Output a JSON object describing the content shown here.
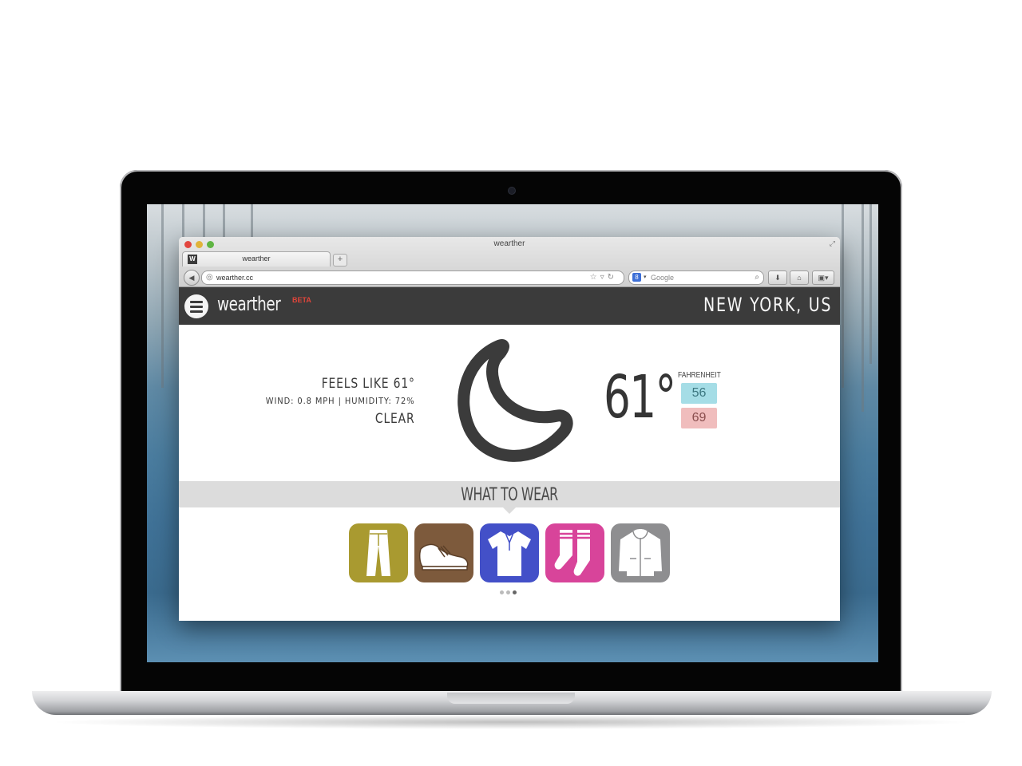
{
  "browser": {
    "window_title": "wearther",
    "tab_label": "wearther",
    "tab_favicon": "W",
    "new_tab": "+",
    "url": "wearther.cc",
    "search_placeholder": "Google"
  },
  "site": {
    "brand": "wearther",
    "beta": "BETA",
    "location": "NEW YORK, US"
  },
  "weather": {
    "feels_like": "FEELS LIKE 61°",
    "wind_humidity": "WIND: 0.8 MPH | HUMIDITY: 72%",
    "condition": "CLEAR",
    "condition_icon": "moon-icon",
    "temperature": "61°",
    "unit": "FAHRENHEIT",
    "low": "56",
    "high": "69"
  },
  "wear": {
    "title": "WHAT TO WEAR",
    "items": [
      {
        "name": "pants-icon",
        "color": "#a99a30"
      },
      {
        "name": "shoe-icon",
        "color": "#7d5a3c"
      },
      {
        "name": "polo-shirt-icon",
        "color": "#4350c8"
      },
      {
        "name": "socks-icon",
        "color": "#d8449a"
      },
      {
        "name": "hoodie-icon",
        "color": "#8e8e90"
      }
    ],
    "pagination_active": 3
  },
  "colors": {
    "header_bg": "#3b3b3b",
    "beta": "#e0453b",
    "low_box": "#a5dde6",
    "high_box": "#f0bdbd"
  }
}
